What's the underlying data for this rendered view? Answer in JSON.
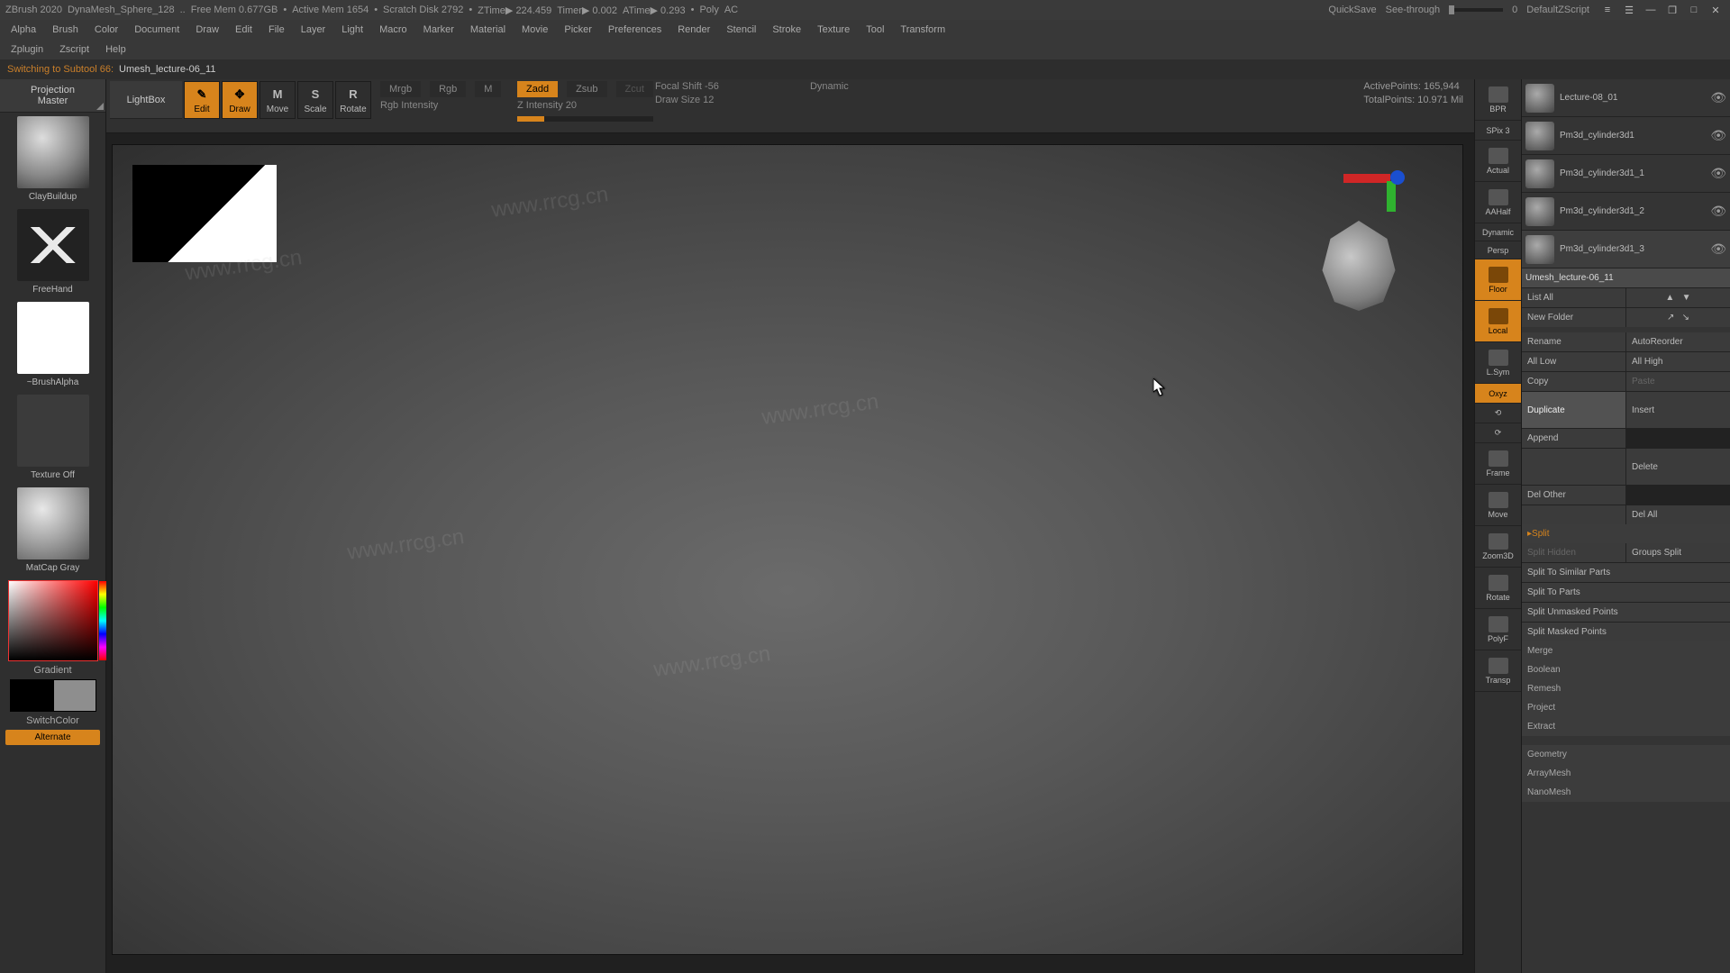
{
  "app": {
    "name": "ZBrush 2020",
    "doc": "DynaMesh_Sphere_128",
    "stats": [
      "Free Mem 0.677GB",
      "Active Mem 1654",
      "Scratch Disk 2792",
      "ZTime▶ 224.459",
      "Timer▶ 0.002",
      "ATime▶ 0.293",
      "Poly",
      "AC"
    ],
    "quicksave": "QuickSave",
    "seethrough": "See-through",
    "seethrough_val": "0",
    "defaultscript": "DefaultZScript"
  },
  "menus": [
    "Alpha",
    "Brush",
    "Color",
    "Document",
    "Draw",
    "Edit",
    "File",
    "Layer",
    "Light",
    "Macro",
    "Marker",
    "Material",
    "Movie",
    "Picker",
    "Preferences",
    "Render",
    "Stencil",
    "Stroke",
    "Texture",
    "Tool",
    "Transform"
  ],
  "helpmenus": [
    "Zplugin",
    "Zscript",
    "Help"
  ],
  "status": {
    "switching": "Switching to Subtool 66:",
    "doc": "Umesh_lecture-06_11"
  },
  "shelf": {
    "projmaster1": "Projection",
    "projmaster2": "Master",
    "lightbox": "LightBox",
    "modes": {
      "edit": "Edit",
      "draw": "Draw",
      "move": "Move",
      "scale": "Scale",
      "rotate": "Rotate"
    },
    "blend": {
      "mrgb": "Mrgb",
      "rgb": "Rgb",
      "m": "M",
      "rgbi": "Rgb Intensity",
      "zadd": "Zadd",
      "zsub": "Zsub",
      "zcut": "Zcut",
      "zint": "Z Intensity 20",
      "fshift": "Focal Shift -56",
      "dsize": "Draw Size 12",
      "dynamic": "Dynamic"
    },
    "stats": {
      "active": "ActivePoints: 165,944",
      "total": "TotalPoints: 10.971 Mil"
    }
  },
  "left": {
    "brush": "ClayBuildup",
    "stroke": "FreeHand",
    "alpha": "~BrushAlpha",
    "texture": "Texture Off",
    "matcap": "MatCap Gray",
    "gradient": "Gradient",
    "switch": "SwitchColor",
    "alternate": "Alternate"
  },
  "nav": {
    "bpr": "BPR",
    "spix": "SPix 3",
    "actual": "Actual",
    "aahalf": "AAHalf",
    "dynamic": "Dynamic",
    "persp": "Persp",
    "floor": "Floor",
    "local": "Local",
    "lsym": "L.Sym",
    "xyz": "Oxyz",
    "frame": "Frame",
    "move": "Move",
    "zoom": "Zoom3D",
    "rotate": "Rotate",
    "polyf": "PolyF",
    "transp": "Transp"
  },
  "subtools": [
    {
      "name": "Lecture-08_01"
    },
    {
      "name": "Pm3d_cylinder3d1"
    },
    {
      "name": "Pm3d_cylinder3d1_1"
    },
    {
      "name": "Pm3d_cylinder3d1_2"
    },
    {
      "name": "Pm3d_cylinder3d1_3"
    }
  ],
  "subtools_name": "Umesh_lecture-06_11",
  "panel": {
    "listall": "List All",
    "newfolder": "New Folder",
    "rename": "Rename",
    "autoreorder": "AutoReorder",
    "alllow": "All Low",
    "allhigh": "All High",
    "copy": "Copy",
    "paste": "Paste",
    "duplicate": "Duplicate",
    "append": "Append",
    "insert": "Insert",
    "delete": "Delete",
    "delother": "Del Other",
    "delall": "Del All",
    "split": "Split",
    "splithidden": "Split Hidden",
    "groupssplit": "Groups Split",
    "simparts": "Split To Similar Parts",
    "toparts": "Split To Parts",
    "unmasked": "Split Unmasked Points",
    "masked": "Split Masked Points",
    "merge": "Merge",
    "boolean": "Boolean",
    "remesh": "Remesh",
    "project": "Project",
    "extract": "Extract",
    "geometry": "Geometry",
    "arraymesh": "ArrayMesh",
    "nanomesh": "NanoMesh"
  },
  "watermark": "www.rrcg.cn"
}
